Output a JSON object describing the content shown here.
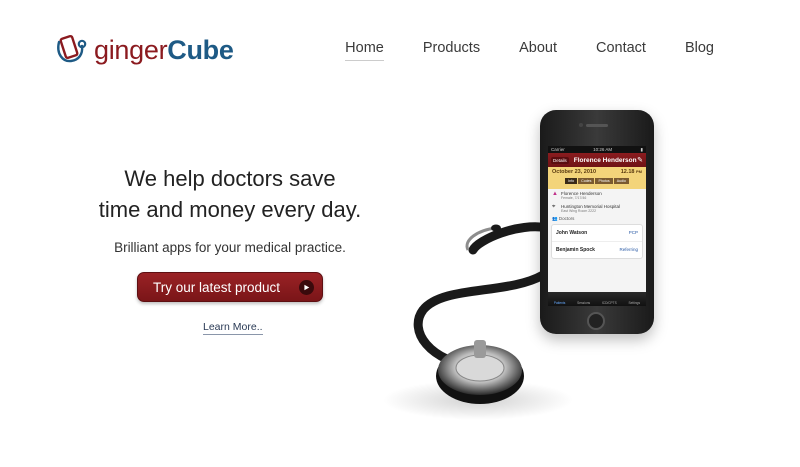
{
  "brand": {
    "name_part1": "ginger",
    "name_part2": "Cube",
    "color1": "#8b1a1f",
    "color2": "#1e5a85"
  },
  "nav": {
    "items": [
      {
        "label": "Home",
        "active": true
      },
      {
        "label": "Products",
        "active": false
      },
      {
        "label": "About",
        "active": false
      },
      {
        "label": "Contact",
        "active": false
      },
      {
        "label": "Blog",
        "active": false
      }
    ]
  },
  "hero": {
    "headline_line1": "We help doctors save",
    "headline_line2": "time and money every day.",
    "subline": "Brilliant apps for your medical practice.",
    "cta_label": "Try our latest product",
    "cta_icon": "play-arrow-icon",
    "learn_more": "Learn More.."
  },
  "phone": {
    "status_left": "Carrier",
    "status_time": "10:26 AM",
    "back_label": "Details",
    "title": "Florence Henderson",
    "date": "October 23, 2010",
    "time": "12.18",
    "time_suffix": "PM",
    "tabs": [
      "Info",
      "Codes",
      "Photos",
      "Audio"
    ],
    "patient_name": "Florence Henderson",
    "patient_sub": "Female, 7/17/46",
    "location": "Huntington Memorial Hospital",
    "location_sub": "East Wing Room 2222",
    "doctors_label": "Doctors",
    "doctors": [
      {
        "name": "John Watson",
        "role": "PCP"
      },
      {
        "name": "Benjamin Spock",
        "role": "Referring"
      }
    ],
    "tabbar": [
      "Patients",
      "Sessions",
      "ICD/CPTS",
      "Settings"
    ]
  }
}
